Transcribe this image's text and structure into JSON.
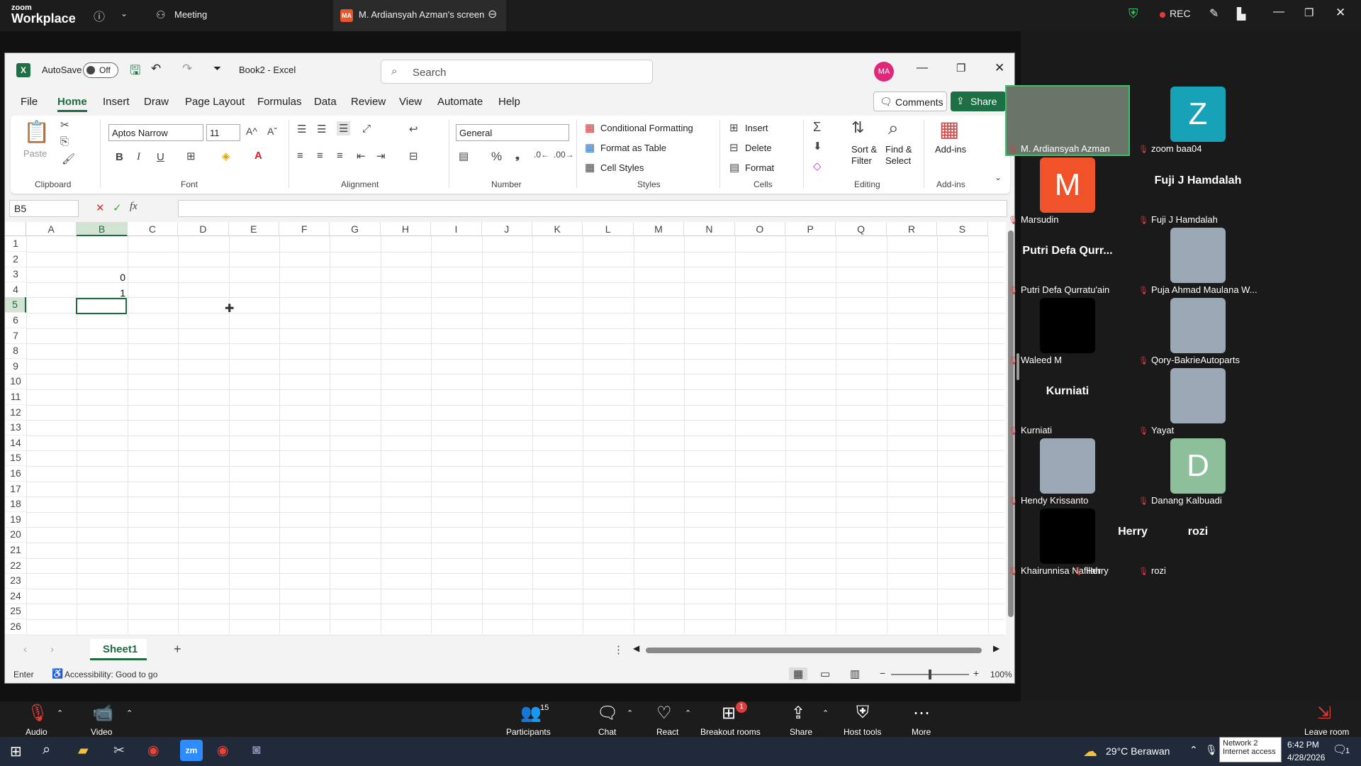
{
  "zoom": {
    "logo_small": "zoom",
    "logo_big": "Workplace",
    "meeting_label": "Meeting",
    "screen_tab_badge": "MA",
    "screen_tab_label": "M. Ardiansyah Azman's screen",
    "rec_label": "REC"
  },
  "excel": {
    "autosave_label": "AutoSave",
    "autosave_state": "Off",
    "title": "Book2  -  Excel",
    "search_placeholder": "Search",
    "user_initials": "MA",
    "menu": [
      "File",
      "Home",
      "Insert",
      "Draw",
      "Page Layout",
      "Formulas",
      "Data",
      "Review",
      "View",
      "Automate",
      "Help"
    ],
    "comments_label": "Comments",
    "share_label": "Share",
    "ribbon": {
      "paste": "Paste",
      "clipboard": "Clipboard",
      "font_name": "Aptos Narrow",
      "font_size": "11",
      "font_group": "Font",
      "alignment_group": "Alignment",
      "number_format": "General",
      "number_group": "Number",
      "conditional_formatting": "Conditional Formatting",
      "format_as_table": "Format as Table",
      "cell_styles": "Cell Styles",
      "styles_group": "Styles",
      "insert": "Insert",
      "delete": "Delete",
      "format": "Format",
      "cells_group": "Cells",
      "sort_filter_1": "Sort &",
      "sort_filter_2": "Filter",
      "find_select_1": "Find &",
      "find_select_2": "Select",
      "editing_group": "Editing",
      "addins": "Add-ins",
      "addins_group": "Add-ins"
    },
    "name_box": "B5",
    "columns": [
      "A",
      "B",
      "C",
      "D",
      "E",
      "F",
      "G",
      "H",
      "I",
      "J",
      "K",
      "L",
      "M",
      "N",
      "O",
      "P",
      "Q",
      "R",
      "S"
    ],
    "rows": [
      "1",
      "2",
      "3",
      "4",
      "5",
      "6",
      "7",
      "8",
      "9",
      "10",
      "11",
      "12",
      "13",
      "14",
      "15",
      "16",
      "17",
      "18",
      "19",
      "20",
      "21",
      "22",
      "23",
      "24",
      "25",
      "26"
    ],
    "cells": [
      {
        "ref": "B3",
        "value": "0"
      },
      {
        "ref": "B4",
        "value": "1"
      }
    ],
    "sheet_tab": "Sheet1",
    "status_mode": "Enter",
    "accessibility": "Accessibility: Good to go",
    "zoom_level": "100%"
  },
  "participants": [
    {
      "name": "M. Ardiansyah Azman",
      "display": "video",
      "active": true
    },
    {
      "name": "zoom baa04",
      "display": "Z",
      "color": "#17a2b8"
    },
    {
      "name": "Marsudin",
      "display": "M",
      "color": "#f0522a"
    },
    {
      "name": "Fuji J Hamdalah",
      "display": "Fuji J Hamdalah"
    },
    {
      "name": "Putri Defa Qurratu'ain",
      "display": "Putri Defa Qurr..."
    },
    {
      "name": "Puja Ahmad Maulana W...",
      "display": "photo"
    },
    {
      "name": "Waleed M",
      "display": "black"
    },
    {
      "name": "Qory-BakrieAutoparts",
      "display": "photo"
    },
    {
      "name": "Kurniati",
      "display": "Kurniati"
    },
    {
      "name": "Yayat",
      "display": "photo"
    },
    {
      "name": "Hendy Krissanto",
      "display": "photo"
    },
    {
      "name": "Danang Kalbuadi",
      "display": "D",
      "color": "#8dbf9a"
    },
    {
      "name": "Khairunnisa Nafilah",
      "display": "black"
    },
    {
      "name": "rozi",
      "display": "rozi"
    },
    {
      "name": "Herry",
      "display": "Herry"
    }
  ],
  "bottom_bar": {
    "audio": "Audio",
    "video": "Video",
    "participants": "Participants",
    "participants_count": "15",
    "chat": "Chat",
    "react": "React",
    "breakout": "Breakout rooms",
    "breakout_badge": "1",
    "share": "Share",
    "host_tools": "Host tools",
    "more": "More",
    "leave": "Leave room"
  },
  "taskbar": {
    "weather": "29°C  Berawan",
    "network_1": "Network 2",
    "network_2": "Internet access",
    "time": "6:42 PM",
    "date": "4/28/2026",
    "notif": "1"
  }
}
